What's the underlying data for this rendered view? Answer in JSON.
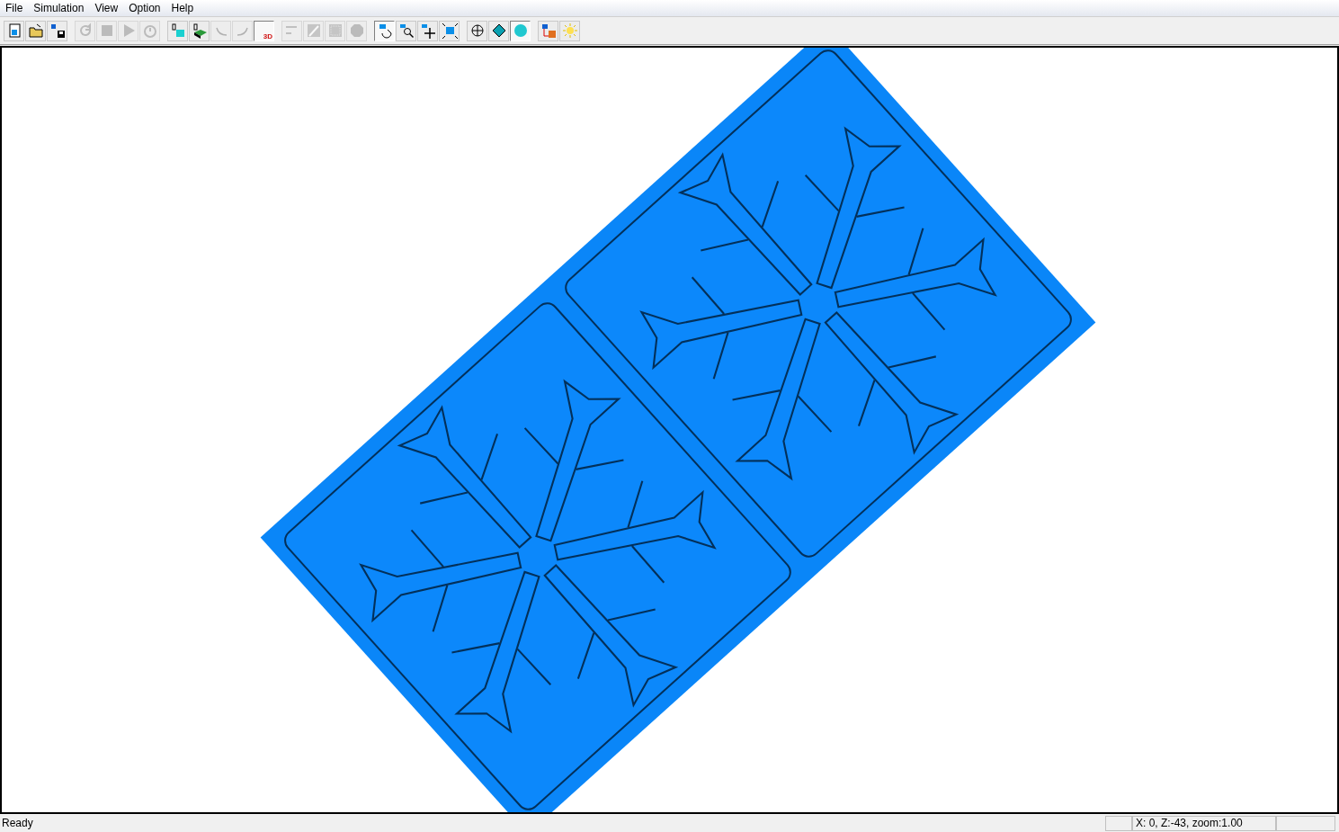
{
  "menu": [
    {
      "label": "File"
    },
    {
      "label": "Simulation"
    },
    {
      "label": "View"
    },
    {
      "label": "Option"
    },
    {
      "label": "Help"
    }
  ],
  "toolbar": [
    [
      {
        "kind": "new",
        "disabled": false,
        "selected": false
      },
      {
        "kind": "open",
        "disabled": false,
        "selected": false
      },
      {
        "kind": "export",
        "disabled": false,
        "selected": false
      }
    ],
    [
      {
        "kind": "rewind",
        "disabled": true,
        "selected": false
      },
      {
        "kind": "stop",
        "disabled": true,
        "selected": false
      },
      {
        "kind": "play",
        "disabled": true,
        "selected": false
      },
      {
        "kind": "timer",
        "disabled": true,
        "selected": false
      }
    ],
    [
      {
        "kind": "tool-cube",
        "disabled": false,
        "selected": false
      },
      {
        "kind": "tool-stock",
        "disabled": false,
        "selected": false
      },
      {
        "kind": "curve-left",
        "disabled": true,
        "selected": false
      },
      {
        "kind": "curve-right",
        "disabled": true,
        "selected": false
      },
      {
        "kind": "view3d",
        "label": "3D",
        "disabled": false,
        "selected": true
      }
    ],
    [
      {
        "kind": "path",
        "disabled": true,
        "selected": false
      },
      {
        "kind": "edge",
        "disabled": true,
        "selected": false
      },
      {
        "kind": "frame",
        "disabled": true,
        "selected": false
      },
      {
        "kind": "octagon",
        "disabled": true,
        "selected": false
      }
    ],
    [
      {
        "kind": "rotate",
        "disabled": false,
        "selected": true
      },
      {
        "kind": "zoom",
        "disabled": false,
        "selected": false
      },
      {
        "kind": "pan",
        "disabled": false,
        "selected": false
      },
      {
        "kind": "fit",
        "disabled": false,
        "selected": false
      }
    ],
    [
      {
        "kind": "wireframe",
        "disabled": false,
        "selected": false
      },
      {
        "kind": "shaded",
        "disabled": false,
        "selected": false
      },
      {
        "kind": "smooth",
        "disabled": false,
        "selected": true
      }
    ],
    [
      {
        "kind": "material",
        "disabled": false,
        "selected": false
      },
      {
        "kind": "light",
        "disabled": false,
        "selected": false
      }
    ]
  ],
  "status_bar": {
    "message": "Ready",
    "coordinates": "X:  0, Z:-43, zoom:1.00"
  }
}
